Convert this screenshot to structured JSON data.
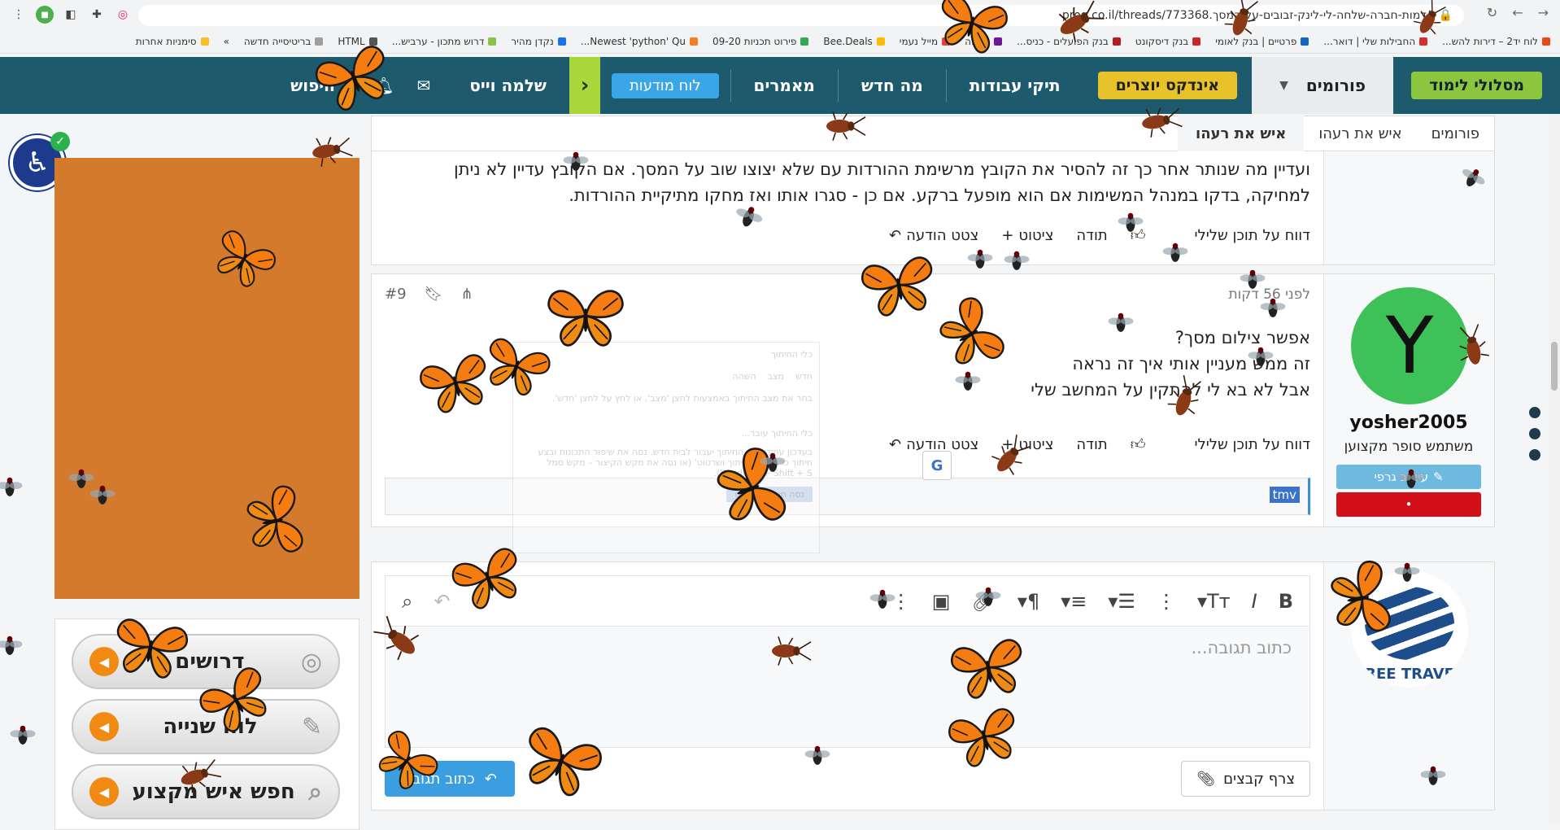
{
  "browser": {
    "url": "prog.co.il/threads/773368.דמות-חברה-שלחה-לי-לינק-זבובים-על-המסך/"
  },
  "bookmarks": [
    {
      "label": "לוח יד2 – דירות להש...",
      "color": "#e64a19"
    },
    {
      "label": "החבילות שלי | דואר...",
      "color": "#d32f2f"
    },
    {
      "label": "פרטיים | בנק לאומי",
      "color": "#1565c0"
    },
    {
      "label": "בנק דיסקונט",
      "color": "#c62828"
    },
    {
      "label": "בנק הפועלים - כניס...",
      "color": "#b71c1c"
    },
    {
      "label": "מניפה",
      "color": "#6a1b9a"
    },
    {
      "label": "מייל נעמי",
      "color": "#ea4335"
    },
    {
      "label": "Bee.Deals",
      "color": "#fbbc05"
    },
    {
      "label": "פירוט תכניות 09-20",
      "color": "#34a853"
    },
    {
      "label": "Newest 'python' Qu...",
      "color": "#f48024"
    },
    {
      "label": "נקדן מהיר",
      "color": "#1a73e8"
    },
    {
      "label": "דרוש מתכון - ערביש...",
      "color": "#8bc34a"
    },
    {
      "label": "HTML",
      "color": "#555555"
    },
    {
      "label": "בריטיסייה חדשה",
      "color": "#9e9e9e"
    },
    {
      "label": "»",
      "color": ""
    },
    {
      "label": "סימניות אחרות",
      "color": "#f6c026"
    }
  ],
  "nav": {
    "learning_paths": "מסלולי לימוד",
    "forums": "פורומים",
    "creators_index": "אינדקס יוצרים",
    "portfolios": "תיקי עבודות",
    "whats_new": "מה חדש",
    "articles": "מאמרים",
    "bulletin": "לוח מודעות",
    "greeting": "שלמה וייס",
    "search": "חיפוש"
  },
  "breadcrumbs": [
    {
      "label": "פורומים"
    },
    {
      "label": "איש את רעהו"
    },
    {
      "label": "איש את רעהו"
    }
  ],
  "post8": {
    "text_line1": "ועדיין מה שנותר אחר כך זה להסיר את הקובץ מרשימת ההורדות עם שלא יצוצו שוב על המסך. אם הקובץ עדיין לא ניתן",
    "text_line2": "למחיקה, בדקו במנהל המשימות אם הוא מופעל ברקע. אם כן - סגרו אותו ואז מחקו מתיקיית ההורדות.",
    "report": "דווח על תוכן שלילי",
    "like": "תודה",
    "quote": "ציטוט",
    "reply": "צטט הודעה"
  },
  "post9": {
    "time": "לפני 56 דקות",
    "number": "#9",
    "line1": "אפשר צילום מסך?",
    "line2": "זה ממש מעניין אותי איך זה נראה",
    "line3": "אבל לא בא לי להתקין על המחשב שלי",
    "report": "דווח על תוכן שלילי",
    "like": "תודה",
    "quote": "ציטוט",
    "reply": "צטט הודעה",
    "input_value": "tmv",
    "user": {
      "avatar_letter": "Y",
      "name": "yosher2005",
      "title": "משתמש סופר מקצוען",
      "edit_button": "עיצוב גרפי",
      "badge": "•"
    }
  },
  "reply": {
    "placeholder": "כתוב תגובה...",
    "attach": "צרף קבצים",
    "submit": "כתוב תגובה",
    "logo_text": "REE TRAVE"
  },
  "side_menu": [
    {
      "label": "דרושים"
    },
    {
      "label": "לוח שנייה"
    },
    {
      "label": "חפש איש מקצוע"
    }
  ],
  "ghost_dialog": {
    "title": "כלי החיתוך",
    "new": "חדש",
    "mode": "מצב",
    "delay": "השהה",
    "hint": "בחר את מצב החיתוך באמצעות לחצן 'מצב', או לחץ על לחצן 'חדש'.",
    "moving": "כלי החיתוך עובר...",
    "body": "בעדכון עתידי, כלי החיתוך יעבור לבית חדש. נסה את שיפור התכונות ובצע חיתוך כרגיל עם 'חיתוך ושרטוט' (או נסה את מקש הקיצור – מקש סמל Windows + Shift + S).",
    "button": "נסה חיתוך ושרטוט"
  }
}
